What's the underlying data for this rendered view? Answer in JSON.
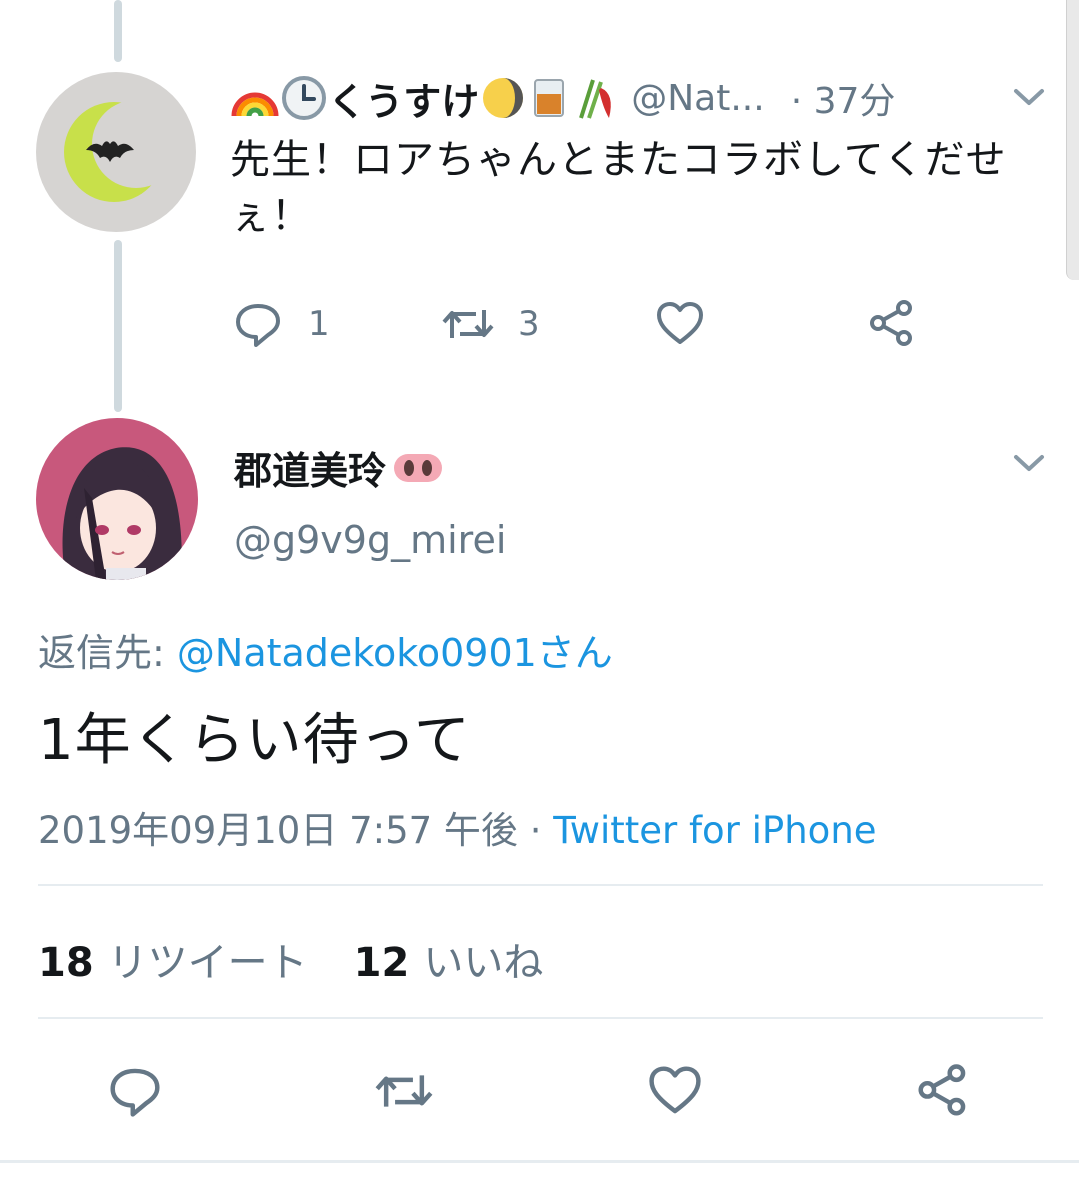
{
  "parent_tweet": {
    "display_name": "くうすけ",
    "handle": "@Nat...",
    "separator": "·",
    "time": "37分",
    "text": "先生！ロアちゃんとまたコラボしてくだせぇ！",
    "reply_count": "1",
    "retweet_count": "3"
  },
  "main_tweet": {
    "display_name": "郡道美玲",
    "handle": "@g9v9g_mirei",
    "reply_to_label": "返信先: ",
    "reply_to_user": "@Natadekoko0901さん",
    "text": "1年くらい待って",
    "date": "2019年09月10日 7:57 午後",
    "separator": " · ",
    "source": "Twitter for iPhone",
    "retweets_count": "18",
    "retweets_label": "リツイート",
    "likes_count": "12",
    "likes_label": "いいね"
  },
  "colors": {
    "link": "#1b95e0",
    "secondary_text": "#657786",
    "thread_line": "#cfd9de"
  }
}
